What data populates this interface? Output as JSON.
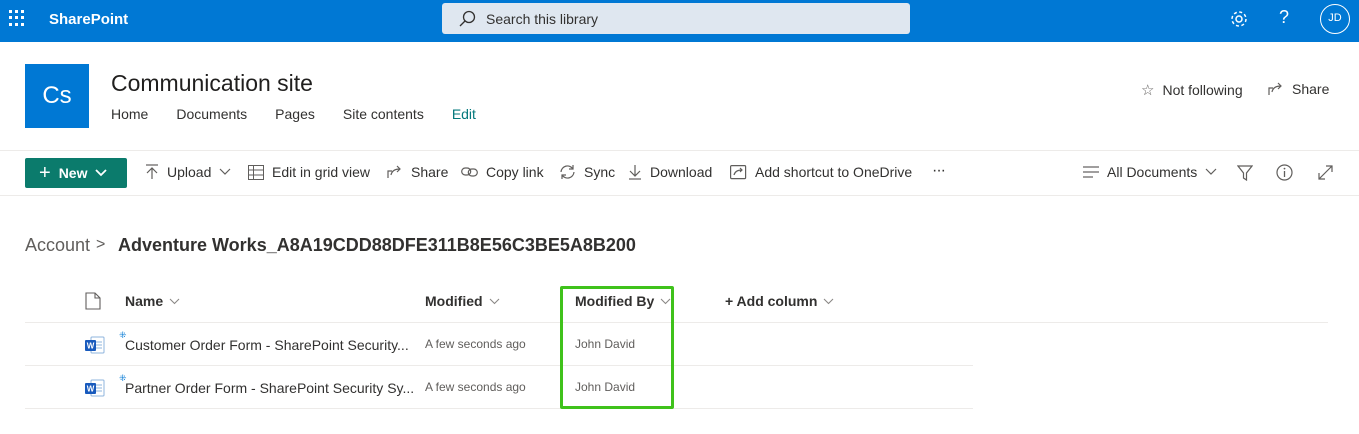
{
  "suite": {
    "brand": "SharePoint",
    "search_placeholder": "Search this library",
    "avatar_initials": "JD",
    "help_label": "?"
  },
  "site": {
    "logo_text": "Cs",
    "title": "Communication site",
    "nav": [
      "Home",
      "Documents",
      "Pages",
      "Site contents",
      "Edit"
    ],
    "follow_label": "Not following",
    "share_label": "Share"
  },
  "commandbar": {
    "new_label": "New",
    "upload_label": "Upload",
    "grid_label": "Edit in grid view",
    "share_label": "Share",
    "copylink_label": "Copy link",
    "sync_label": "Sync",
    "download_label": "Download",
    "shortcut_label": "Add shortcut to OneDrive",
    "more_label": "···",
    "view_label": "All Documents"
  },
  "breadcrumb": {
    "root": "Account",
    "separator": ">",
    "current": "Adventure Works_A8A19CDD88DFE311B8E56C3BE5A8B200"
  },
  "list": {
    "columns": {
      "name": "Name",
      "modified": "Modified",
      "modified_by": "Modified By",
      "add_column": "+ Add column"
    },
    "rows": [
      {
        "name": "Customer Order Form - SharePoint Security...",
        "modified": "A few seconds ago",
        "modified_by": "John David",
        "icon": "word-doc-icon"
      },
      {
        "name": "Partner Order Form - SharePoint Security Sy...",
        "modified": "A few seconds ago",
        "modified_by": "John David",
        "icon": "word-doc-icon"
      }
    ]
  },
  "colors": {
    "suite_bar": "#0078d4",
    "new_button": "#0b7b6c",
    "highlight_box": "#3fc21b",
    "edit_link": "#03787c"
  }
}
